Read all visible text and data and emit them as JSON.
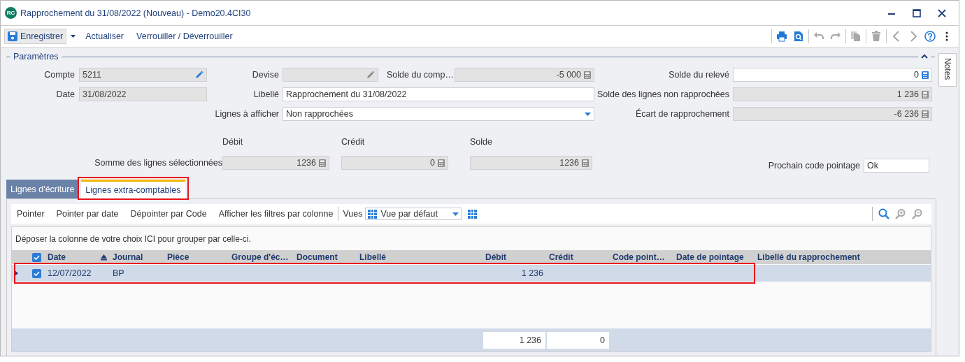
{
  "window": {
    "badge": "RC",
    "title": "Rapprochement du 31/08/2022 (Nouveau) - Demo20.4CI30",
    "controls": [
      {
        "kind": "minimize"
      },
      {
        "kind": "maximize"
      },
      {
        "kind": "close"
      }
    ]
  },
  "toolbar": {
    "save": {
      "label": "Enregistrer",
      "has_menu": true
    },
    "actions": [
      "Actualiser",
      "Verrouiller / Déverrouiller"
    ],
    "tools": [
      {
        "kind": "print",
        "disabled": false
      },
      {
        "kind": "preview",
        "disabled": false
      },
      {
        "kind": "undo",
        "disabled": true
      },
      {
        "kind": "redo",
        "disabled": true
      },
      {
        "kind": "copy",
        "disabled": true
      },
      {
        "kind": "delete",
        "disabled": true
      },
      {
        "kind": "previous",
        "disabled": true
      },
      {
        "kind": "next",
        "disabled": true
      },
      {
        "kind": "help",
        "disabled": false
      },
      {
        "kind": "more"
      }
    ]
  },
  "section": {
    "title": "Paramètres",
    "expanded": true
  },
  "side_tab": "Notes",
  "form": {
    "left": [
      {
        "label": "Compte",
        "value": "5211",
        "kind": "edit",
        "disabled": true,
        "icon_enabled": true
      },
      {
        "label": "Date",
        "value": "31/08/2022",
        "kind": "plain",
        "disabled": true
      }
    ],
    "middle": [
      [
        {
          "label": "Devise",
          "kind": "edit",
          "disabled": true,
          "icon_enabled": false
        },
        {
          "label": "Solde du comp…",
          "value": "-5 000",
          "kind": "calc",
          "disabled": true,
          "icon_enabled": false
        }
      ],
      [
        {
          "label": "Libellé",
          "value": "Rapprochement du 31/08/2022",
          "kind": "plain",
          "disabled": false
        }
      ],
      [
        {
          "label": "Lignes à afficher",
          "value": "Non rapprochées",
          "kind": "dropdown",
          "disabled": false,
          "icon_enabled": true
        }
      ]
    ],
    "right": [
      {
        "label": "Solde du relevé",
        "value": "0",
        "kind": "calc",
        "disabled": false,
        "icon_enabled": true
      },
      {
        "label": "Solde des lignes non rapprochées",
        "value": "1 236",
        "kind": "calc",
        "disabled": true,
        "icon_enabled": false
      },
      {
        "label": "Écart de rapprochement",
        "value": "-6 236",
        "kind": "calc",
        "disabled": true,
        "icon_enabled": false
      }
    ]
  },
  "selection_totals": {
    "label": "Somme des lignes sélectionnées",
    "columns": [
      {
        "heading": "Débit",
        "value": "1236"
      },
      {
        "heading": "Crédit",
        "value": "0"
      },
      {
        "heading": "Solde",
        "value": "1236"
      }
    ]
  },
  "next_code": {
    "label": "Prochain code pointage",
    "value": "Ok"
  },
  "tabs": [
    {
      "label": "Lignes d'écriture",
      "selected": false,
      "highlighted": false
    },
    {
      "label": "Lignes extra-comptables",
      "selected": true,
      "highlighted": true
    }
  ],
  "grid_toolbar": {
    "actions": [
      "Pointer",
      "Pointer par date",
      "Dépointer par Code",
      "Afficher les filtres par colonne"
    ],
    "views_label": "Vues",
    "view": "Vue par défaut",
    "tools": [
      {
        "kind": "search",
        "disabled": false
      },
      {
        "kind": "zoom-in",
        "disabled": true
      },
      {
        "kind": "zoom-out",
        "disabled": true
      }
    ]
  },
  "group_hint": "Déposer la colonne de votre choix ICI pour grouper par celle-ci.",
  "table": {
    "all_checked": true,
    "columns": [
      {
        "label": "Date",
        "sorted": true
      },
      {
        "label": "Journal",
        "sorted": false
      },
      {
        "label": "Pièce",
        "sorted": false
      },
      {
        "label": "Groupe d'éc…",
        "sorted": false
      },
      {
        "label": "Document",
        "sorted": false
      },
      {
        "label": "Libellé",
        "sorted": false
      },
      {
        "label": "Débit",
        "sorted": false,
        "summary": "1 236"
      },
      {
        "label": "Crédit",
        "sorted": false,
        "summary": "0"
      },
      {
        "label": "Code point…",
        "sorted": false
      },
      {
        "label": "Date de pointage",
        "sorted": false
      },
      {
        "label": "Libellé du rapprochement",
        "sorted": false
      }
    ],
    "rows": [
      {
        "expanded": false,
        "checked": true,
        "selected": true,
        "highlighted": true,
        "cells": [
          "12/07/2022",
          "BP",
          null,
          null,
          null,
          null,
          "1 236",
          null,
          null,
          null,
          null
        ]
      }
    ]
  }
}
